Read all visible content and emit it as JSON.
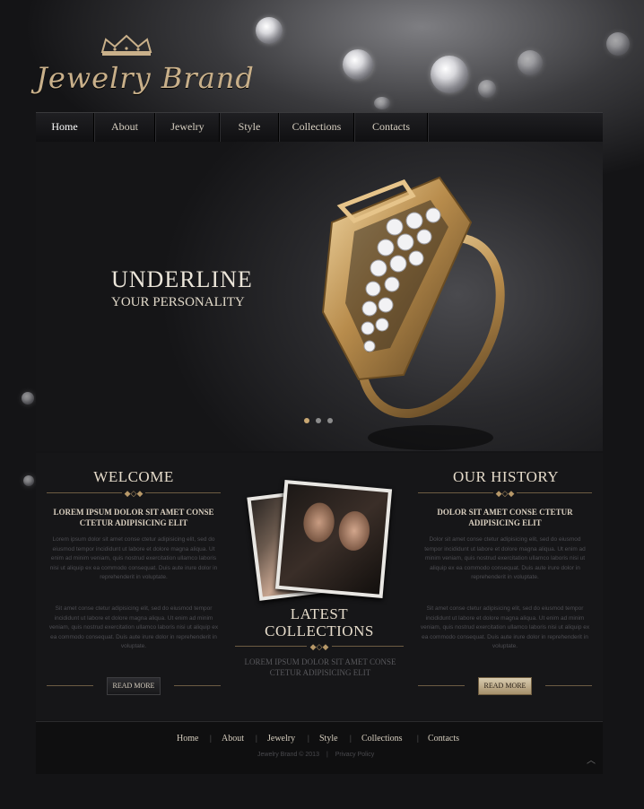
{
  "brand": {
    "name": "Jewelry Brand"
  },
  "nav": {
    "items": [
      {
        "label": "Home"
      },
      {
        "label": "About"
      },
      {
        "label": "Jewelry"
      },
      {
        "label": "Style"
      },
      {
        "label": "Collections"
      },
      {
        "label": "Contacts"
      }
    ],
    "active": "Home"
  },
  "hero": {
    "title": "UNDERLINE",
    "subtitle": "YOUR PERSONALITY",
    "slide_count": 3,
    "active_slide": 1
  },
  "welcome": {
    "title": "WELCOME",
    "lead": "LOREM IPSUM DOLOR SIT AMET CONSE CTETUR ADIPISICING ELIT",
    "para1": "Lorem ipsum dolor sit amet conse ctetur adipisicing elit, sed do eiusmod tempor incididunt ut labore et dolore magna aliqua. Ut enim ad minim veniam, quis nostrud exercitation ullamco laboris nisi ut aliquip ex ea commodo consequat. Duis aute irure dolor in reprehenderit in voluptate.",
    "para2": "Sit amet conse ctetur adipisicing elit, sed do eiusmod tempor incididunt ut labore et dolore magna aliqua. Ut enim ad minim veniam, quis nostrud exercitation ullamco laboris nisi ut aliquip ex ea commodo consequat. Duis aute irure dolor in reprehenderit in voluptate.",
    "button": "READ MORE"
  },
  "collections": {
    "title_line1": "LATEST",
    "title_line2": "COLLECTIONS",
    "lead": "LOREM IPSUM DOLOR SIT AMET CONSE CTETUR ADIPISICING ELIT"
  },
  "history": {
    "title": "OUR HISTORY",
    "lead": "DOLOR SIT AMET CONSE CTETUR ADIPISICING ELIT",
    "para1": "Dolor sit amet conse ctetur adipisicing elit, sed do eiusmod tempor incididunt ut labore et dolore magna aliqua. Ut enim ad minim veniam, quis nostrud exercitation ullamco laboris nisi ut aliquip ex ea commodo consequat. Duis aute irure dolor in reprehenderit in voluptate.",
    "para2": "Sit amet conse ctetur adipisicing elit, sed do eiusmod tempor incididunt ut labore et dolore magna aliqua. Ut enim ad minim veniam, quis nostrud exercitation ullamco laboris nisi ut aliquip ex ea commodo consequat. Duis aute irure dolor in reprehenderit in voluptate.",
    "button": "READ MORE"
  },
  "footer": {
    "links": [
      {
        "label": "Home"
      },
      {
        "label": "About"
      },
      {
        "label": "Jewelry"
      },
      {
        "label": "Style"
      },
      {
        "label": "Collections"
      },
      {
        "label": "Contacts"
      }
    ],
    "separator": "|",
    "copyright": "Jewelry Brand © 2013",
    "privacy": "Privacy Policy"
  },
  "icons": {
    "crown": "crown-icon",
    "ring": "ring-image",
    "to_top": "chevron-up-icon"
  },
  "colors": {
    "gold": "#c9b08a",
    "background": "#0d0d0f",
    "panel": "#161618"
  }
}
